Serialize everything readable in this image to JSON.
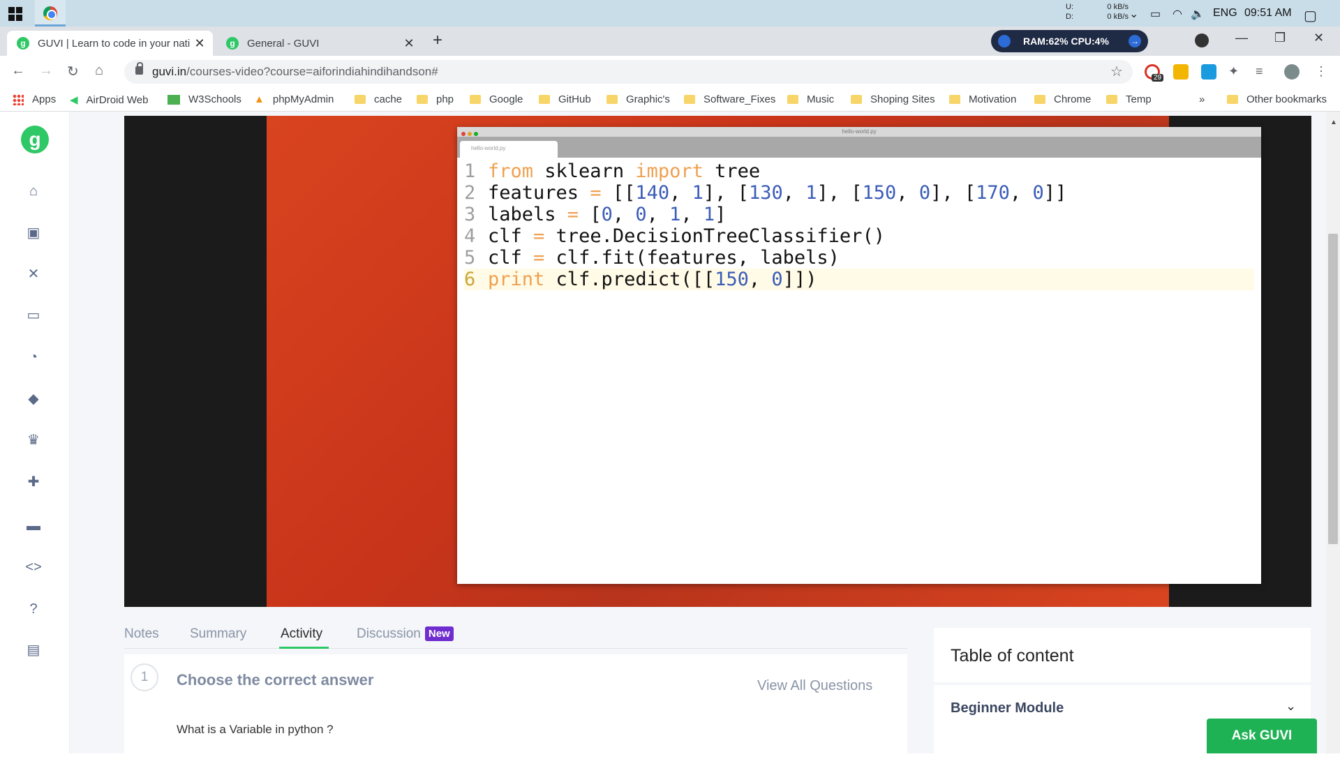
{
  "system": {
    "net_up_label": "U:",
    "net_up_value": "0 kB/s",
    "net_down_label": "D:",
    "net_down_value": "0 kB/s",
    "language": "ENG",
    "time": "09:51 AM"
  },
  "browser": {
    "tabs": [
      {
        "title": "GUVI | Learn to code in your nati",
        "active": true
      },
      {
        "title": "General - GUVI",
        "active": false
      }
    ],
    "ram_cpu": "RAM:62%  CPU:4%",
    "url_host": "guvi.in",
    "url_path": "/courses-video?course=aiforindiahindihandson#",
    "ext_badge": "29",
    "bookmarks": [
      "Apps",
      "AirDroid Web",
      "W3Schools",
      "phpMyAdmin",
      "cache",
      "php",
      "Google",
      "GitHub",
      "Graphic's",
      "Software_Fixes",
      "Music",
      "Shoping Sites",
      "Motivation",
      "Chrome",
      "Temp"
    ],
    "bookmarks_more": "»",
    "other_bookmarks": "Other bookmarks"
  },
  "sidebar": {
    "logo": "g",
    "icons": [
      "home-icon",
      "video-library-icon",
      "practice-icon",
      "laptop-icon",
      "progress-icon",
      "tag-icon",
      "crown-icon",
      "gift-icon",
      "briefcase-icon",
      "code-icon",
      "help-icon",
      "chat-icon"
    ]
  },
  "video": {
    "window_title": "hello-world.py",
    "tab_title": "hello-world.py",
    "code_lines": [
      "from sklearn import tree",
      "features = [[140, 1], [130, 1], [150, 0], [170, 0]]",
      "labels = [0, 0, 1, 1]",
      "clf = tree.DecisionTreeClassifier()",
      "clf = clf.fit(features, labels)",
      "print clf.predict([[150, 0]])"
    ]
  },
  "content_tabs": {
    "notes": "Notes",
    "summary": "Summary",
    "activity": "Activity",
    "discussion": "Discussion",
    "new_badge": "New",
    "active": "Activity"
  },
  "question": {
    "number": "1",
    "title": "Choose the correct answer",
    "view_all": "View All Questions",
    "text": "What is a Variable in python ?"
  },
  "toc": {
    "title": "Table of content",
    "module": "Beginner Module"
  },
  "ask_guvi": "Ask GUVI",
  "colors": {
    "accent_green": "#2ec866",
    "badge_purple": "#6f2ccf",
    "ask_button": "#1fb254"
  }
}
